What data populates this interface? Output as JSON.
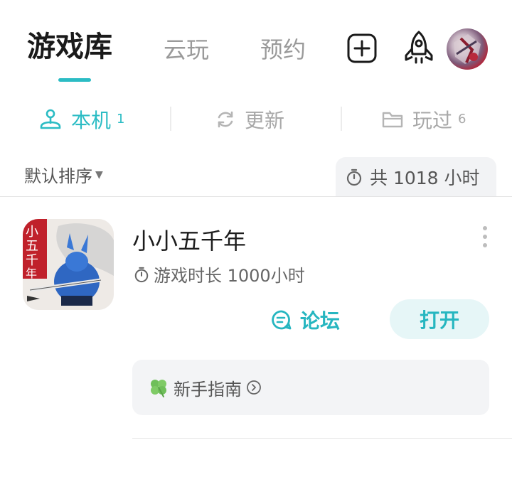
{
  "header": {
    "tabs": [
      {
        "label": "游戏库",
        "active": true
      },
      {
        "label": "云玩",
        "active": false
      },
      {
        "label": "预约",
        "active": false
      }
    ],
    "add_icon": "plus-square-icon",
    "rocket_icon": "rocket-icon",
    "accent_color": "#2bbcc4"
  },
  "subtabs": [
    {
      "label": "本机",
      "count": "1",
      "icon": "joystick-icon",
      "active": true
    },
    {
      "label": "更新",
      "count": "",
      "icon": "refresh-icon",
      "active": false
    },
    {
      "label": "玩过",
      "count": "6",
      "icon": "folder-icon",
      "active": false
    }
  ],
  "toolbar": {
    "sort_label": "默认排序",
    "total_label": "共 1018 小时"
  },
  "games": [
    {
      "title": "小小五千年",
      "playtime": "游戏时长 1000小时",
      "forum_label": "论坛",
      "open_label": "打开",
      "guide_label": "新手指南"
    }
  ]
}
